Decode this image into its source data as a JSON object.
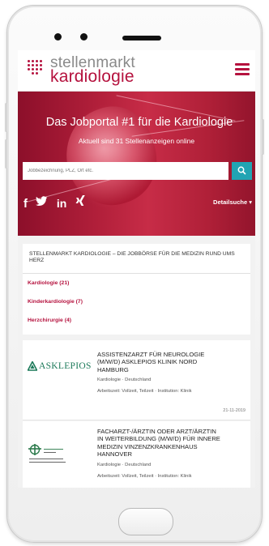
{
  "header": {
    "logo_top": "stellenmarkt",
    "logo_bottom": "kardiologie"
  },
  "hero": {
    "title": "Das Jobportal #1 für die Kardiologie",
    "subtitle": "Aktuell sind 31 Stellenanzeigen online",
    "search_placeholder": "Jobbezeichnung, PLZ, Ort etc.",
    "detail_link": "Detailsuche",
    "social": [
      "f",
      "tw",
      "in",
      "x"
    ]
  },
  "intro": {
    "text": "STELLENMARKT KARDIOLOGIE – DIE JOBBÖRSE FÜR DIE MEDIZIN RUND UMS HERZ"
  },
  "categories": [
    "Kardiologie (21)",
    "Kinderkardiologie (7)",
    "Herzchirurgie (4)"
  ],
  "jobs": [
    {
      "logo_text": "ASKLEPIOS",
      "title_lines": [
        "ASSISTENZARZT FÜR NEUROLOGIE",
        "(M/W/D) ASKLEPIOS KLINIK NORD",
        "HAMBURG"
      ],
      "field": "Kardiologie",
      "country": "Deutschland",
      "meta": "Arbeitszeit: Vollzeit, Teilzeit · Institution: Klinik",
      "date": "21-11-2019"
    },
    {
      "logo_text": "",
      "title_lines": [
        "FACHARZT-/ÄRZTIN ODER ARZT/ÄRZTIN",
        "IN WEITERBILDUNG (M/W/D) FÜR INNERE",
        "MEDIZIN VINZENZKRANKENHAUS",
        "HANNOVER"
      ],
      "field": "Kardiologie",
      "country": "Deutschland",
      "meta": "Arbeitszeit: Vollzeit, Teilzeit · Institution: Klinik",
      "date": ""
    }
  ],
  "colors": {
    "brand": "#b5123e",
    "search_button": "#21a4b3",
    "asklepios_green": "#1d7a5a"
  }
}
